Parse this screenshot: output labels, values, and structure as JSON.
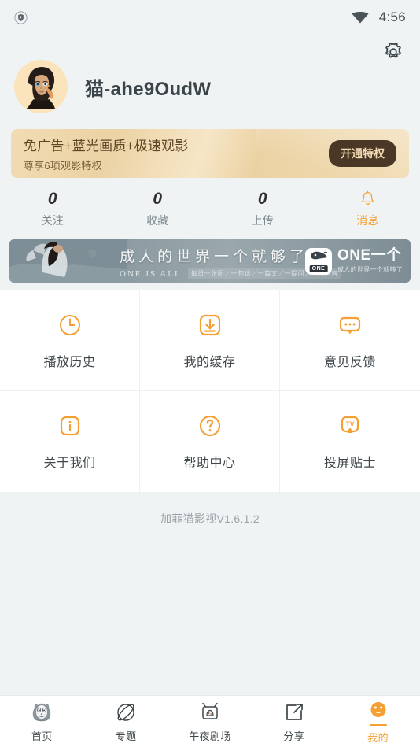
{
  "status_bar": {
    "left_icon": "shield-icon",
    "wifi_icon": "wifi-icon",
    "time": "4:56"
  },
  "header": {
    "settings_icon": "gear-icon",
    "avatar_alt": "avatar",
    "username": "猫-ahe9OudW"
  },
  "vip_banner": {
    "title": "免广告+蓝光画质+极速观影",
    "subtitle": "尊享6项观影特权",
    "button_label": "开通特权",
    "bg_gold": "#ecd2a3",
    "button_bg": "#4a3726",
    "button_text_color": "#f3ddb4"
  },
  "stats": [
    {
      "value": "0",
      "label": "关注",
      "icon": null,
      "accent": false
    },
    {
      "value": "0",
      "label": "收藏",
      "icon": null,
      "accent": false
    },
    {
      "value": "0",
      "label": "上传",
      "icon": null,
      "accent": false
    },
    {
      "value": null,
      "label": "消息",
      "icon": "bell-icon",
      "accent": true
    }
  ],
  "ad_banner": {
    "headline": "成人的世界一个就够了",
    "sub_en": "ONE IS ALL",
    "sub_cn": "每日一张图／一句话／一篇文／一提问／一段声音",
    "logo_tag": "ONE",
    "brand": "ONE一个",
    "brand_slogan": "成人的世界一个就够了"
  },
  "grid": [
    {
      "label": "播放历史",
      "icon": "clock-icon"
    },
    {
      "label": "我的缓存",
      "icon": "download-icon"
    },
    {
      "label": "意见反馈",
      "icon": "chat-bubble-icon"
    },
    {
      "label": "关于我们",
      "icon": "info-icon"
    },
    {
      "label": "帮助中心",
      "icon": "question-icon"
    },
    {
      "label": "投屏贴士",
      "icon": "tv-cast-icon"
    }
  ],
  "version": "加菲猫影视V1.6.1.2",
  "tabbar": {
    "active_color": "#f5a034",
    "items": [
      {
        "label": "首页",
        "icon": "garfield-cat-icon",
        "active": false
      },
      {
        "label": "专题",
        "icon": "planet-icon",
        "active": false
      },
      {
        "label": "午夜剧场",
        "icon": "tv-icon",
        "active": false
      },
      {
        "label": "分享",
        "icon": "share-icon",
        "active": false
      },
      {
        "label": "我的",
        "icon": "smiley-face-icon",
        "active": true
      }
    ]
  }
}
